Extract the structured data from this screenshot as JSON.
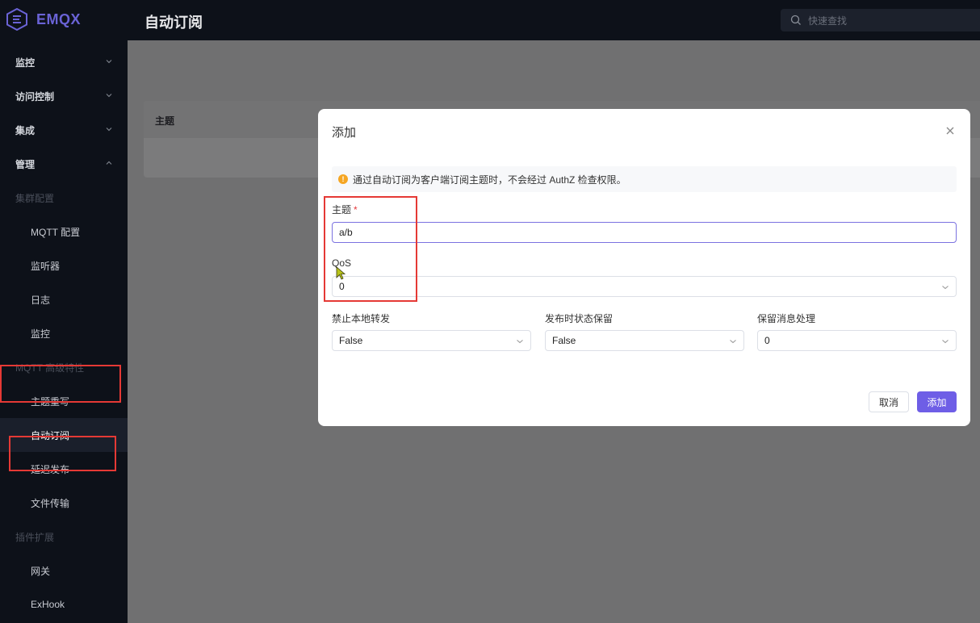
{
  "brand": {
    "name": "EMQX",
    "color": "#6a63d6",
    "icon": "emqx-logo-icon"
  },
  "header": {
    "title": "自动订阅",
    "search_placeholder": "快速查找"
  },
  "sidebar": {
    "top_items": [
      {
        "label": "监控",
        "expanded": false
      },
      {
        "label": "访问控制",
        "expanded": false
      },
      {
        "label": "集成",
        "expanded": false
      },
      {
        "label": "管理",
        "expanded": true
      }
    ],
    "group_cluster": "集群配置",
    "cluster_items": [
      "MQTT 配置",
      "监听器",
      "日志",
      "监控"
    ],
    "group_advanced": "MQTT 高级特性",
    "advanced_items": [
      "主题重写",
      "自动订阅",
      "延迟发布",
      "文件传输"
    ],
    "group_plugins": "插件扩展",
    "plugin_items": [
      "网关",
      "ExHook"
    ]
  },
  "table": {
    "col_topic": "主题"
  },
  "modal": {
    "title": "添加",
    "alert": "通过自动订阅为客户端订阅主题时，不会经过 AuthZ 检查权限。",
    "topic_label": "主题",
    "required_mark": "*",
    "topic_value": "a/b",
    "qos_label": "QoS",
    "qos_value": "0",
    "no_local_label": "禁止本地转发",
    "no_local_value": "False",
    "retain_as_published_label": "发布时状态保留",
    "retain_as_published_value": "False",
    "retain_handling_label": "保留消息处理",
    "retain_handling_value": "0",
    "cancel_label": "取消",
    "submit_label": "添加"
  },
  "colors": {
    "primary": "#6e5ee6",
    "highlight": "#e53935",
    "warning": "#f5a623"
  }
}
